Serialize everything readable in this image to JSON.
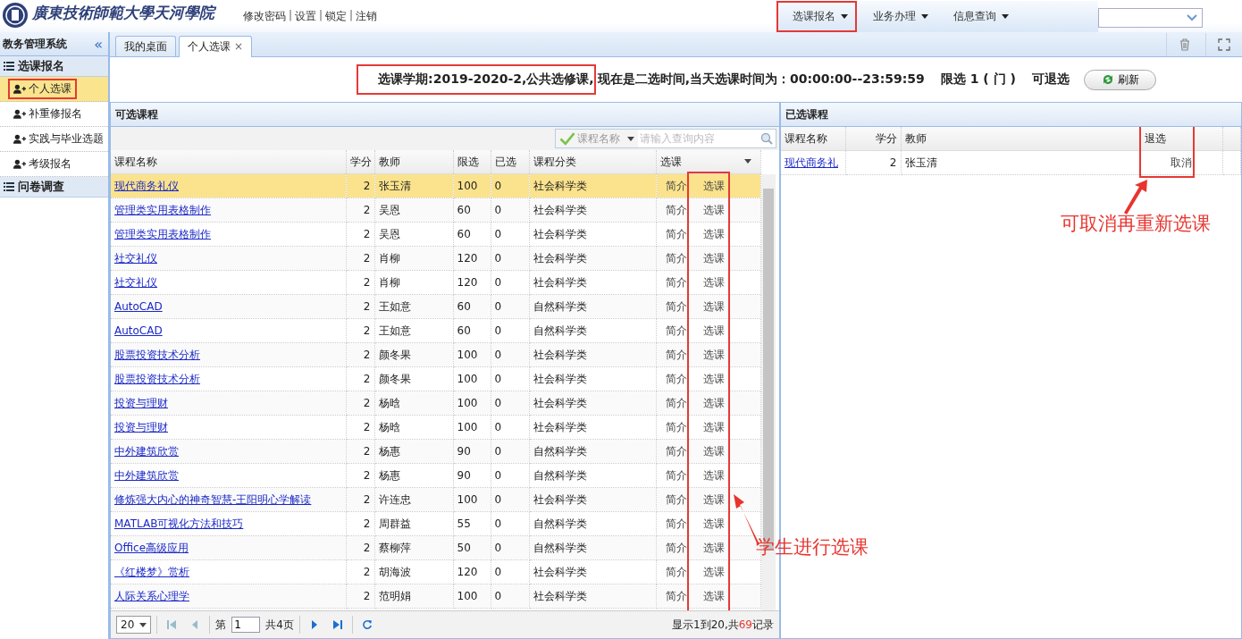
{
  "header": {
    "logo_text": "廣東技術師範大學天河學院",
    "links": [
      "修改密码",
      "设置",
      "锁定",
      "注销"
    ],
    "link_separator": "|",
    "menu": [
      {
        "label": "选课报名",
        "highlighted": true
      },
      {
        "label": "业务办理",
        "highlighted": false
      },
      {
        "label": "信息查询",
        "highlighted": false
      }
    ]
  },
  "sidebar": {
    "title": "教务管理系统",
    "collapse_glyph": "«",
    "groups": [
      {
        "label": "选课报名",
        "items": [
          {
            "label": "个人选课",
            "selected": true,
            "highlighted": true
          },
          {
            "label": "补重修报名",
            "selected": false,
            "highlighted": false
          },
          {
            "label": "实践与毕业选题",
            "selected": false,
            "highlighted": false
          },
          {
            "label": "考级报名",
            "selected": false,
            "highlighted": false
          }
        ]
      },
      {
        "label": "问卷调查"
      }
    ]
  },
  "tabs": [
    {
      "label": "我的桌面",
      "selected": false,
      "closable": false
    },
    {
      "label": "个人选课",
      "selected": true,
      "closable": true
    }
  ],
  "tab_close": "×",
  "notice": {
    "segments": [
      {
        "text": "选课学期:2019-2020-2,公共选修课,",
        "highlighted": true
      },
      {
        "text": "现在是二选时间,当天选课时间为：00:00:00--23:59:59",
        "highlighted": false
      },
      {
        "text": "限选 1 ( 门 )",
        "highlighted": false
      },
      {
        "text": "可退选",
        "highlighted": false
      }
    ],
    "refresh_button": "刷新"
  },
  "available": {
    "title": "可选课程",
    "filter_field": "课程名称",
    "search_placeholder": "请输入查询内容",
    "columns": [
      "课程名称",
      "学分",
      "教师",
      "限选",
      "已选",
      "课程分类",
      "选课"
    ],
    "action_highlighted": true,
    "rows": [
      {
        "name": "现代商务礼仪",
        "credit": "2",
        "teacher": "张玉清",
        "limit": "100",
        "chosen": "0",
        "category": "社会科学类",
        "intro": "简介",
        "action": "选课",
        "selected": true
      },
      {
        "name": "管理类实用表格制作",
        "credit": "2",
        "teacher": "吴恩",
        "limit": "60",
        "chosen": "0",
        "category": "社会科学类",
        "intro": "简介",
        "action": "选课",
        "selected": false
      },
      {
        "name": "管理类实用表格制作",
        "credit": "2",
        "teacher": "吴恩",
        "limit": "60",
        "chosen": "0",
        "category": "社会科学类",
        "intro": "简介",
        "action": "选课",
        "selected": false
      },
      {
        "name": "社交礼仪",
        "credit": "2",
        "teacher": "肖柳",
        "limit": "120",
        "chosen": "0",
        "category": "社会科学类",
        "intro": "简介",
        "action": "选课",
        "selected": false
      },
      {
        "name": "社交礼仪",
        "credit": "2",
        "teacher": "肖柳",
        "limit": "120",
        "chosen": "0",
        "category": "社会科学类",
        "intro": "简介",
        "action": "选课",
        "selected": false
      },
      {
        "name": "AutoCAD",
        "credit": "2",
        "teacher": "王如意",
        "limit": "60",
        "chosen": "0",
        "category": "自然科学类",
        "intro": "简介",
        "action": "选课",
        "selected": false
      },
      {
        "name": "AutoCAD",
        "credit": "2",
        "teacher": "王如意",
        "limit": "60",
        "chosen": "0",
        "category": "自然科学类",
        "intro": "简介",
        "action": "选课",
        "selected": false
      },
      {
        "name": "股票投资技术分析",
        "credit": "2",
        "teacher": "颜冬果",
        "limit": "100",
        "chosen": "0",
        "category": "社会科学类",
        "intro": "简介",
        "action": "选课",
        "selected": false
      },
      {
        "name": "股票投资技术分析",
        "credit": "2",
        "teacher": "颜冬果",
        "limit": "100",
        "chosen": "0",
        "category": "社会科学类",
        "intro": "简介",
        "action": "选课",
        "selected": false
      },
      {
        "name": "投资与理财",
        "credit": "2",
        "teacher": "杨晗",
        "limit": "100",
        "chosen": "0",
        "category": "社会科学类",
        "intro": "简介",
        "action": "选课",
        "selected": false
      },
      {
        "name": "投资与理财",
        "credit": "2",
        "teacher": "杨晗",
        "limit": "100",
        "chosen": "0",
        "category": "社会科学类",
        "intro": "简介",
        "action": "选课",
        "selected": false
      },
      {
        "name": "中外建筑欣赏",
        "credit": "2",
        "teacher": "杨惠",
        "limit": "90",
        "chosen": "0",
        "category": "自然科学类",
        "intro": "简介",
        "action": "选课",
        "selected": false
      },
      {
        "name": "中外建筑欣赏",
        "credit": "2",
        "teacher": "杨惠",
        "limit": "90",
        "chosen": "0",
        "category": "自然科学类",
        "intro": "简介",
        "action": "选课",
        "selected": false
      },
      {
        "name": "修炼强大内心的神奇智慧-王阳明心学解读",
        "credit": "2",
        "teacher": "许连忠",
        "limit": "100",
        "chosen": "0",
        "category": "社会科学类",
        "intro": "简介",
        "action": "选课",
        "selected": false
      },
      {
        "name": "MATLAB可视化方法和技巧",
        "credit": "2",
        "teacher": "周群益",
        "limit": "55",
        "chosen": "0",
        "category": "自然科学类",
        "intro": "简介",
        "action": "选课",
        "selected": false
      },
      {
        "name": "Office高级应用",
        "credit": "2",
        "teacher": "蔡柳萍",
        "limit": "50",
        "chosen": "0",
        "category": "自然科学类",
        "intro": "简介",
        "action": "选课",
        "selected": false
      },
      {
        "name": "《红楼梦》赏析",
        "credit": "2",
        "teacher": "胡海波",
        "limit": "120",
        "chosen": "0",
        "category": "社会科学类",
        "intro": "简介",
        "action": "选课",
        "selected": false
      },
      {
        "name": "人际关系心理学",
        "credit": "2",
        "teacher": "范明娟",
        "limit": "100",
        "chosen": "0",
        "category": "社会科学类",
        "intro": "简介",
        "action": "选课",
        "selected": false
      }
    ],
    "pager": {
      "page_size": "20",
      "page_prefix": "第",
      "page": "1",
      "page_suffix": "共4页",
      "summary_parts": [
        "显示1到20,共",
        "69",
        "记录"
      ]
    }
  },
  "chosen": {
    "title": "已选课程",
    "columns": [
      "课程名称",
      "学分",
      "教师",
      "退选"
    ],
    "withdraw_highlighted": true,
    "rows": [
      {
        "name": "现代商务礼",
        "credit": "2",
        "teacher": "张玉清",
        "action": "取消"
      }
    ]
  },
  "annotations": [
    {
      "text": "可取消再重新选课"
    },
    {
      "text": "学生进行选课"
    }
  ]
}
